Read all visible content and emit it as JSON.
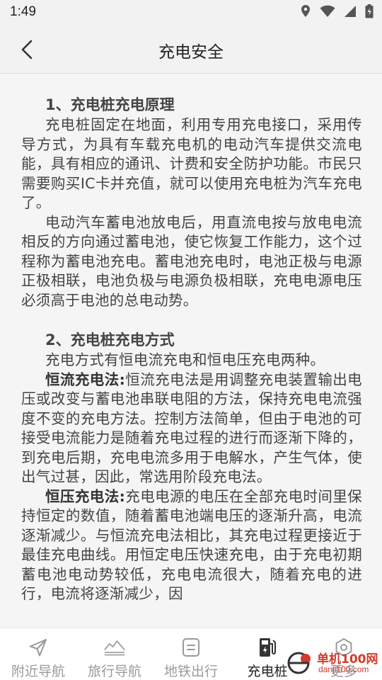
{
  "status_bar": {
    "time": "1:49",
    "icons": [
      "location-icon",
      "wifi-icon",
      "signal-icon",
      "battery-charging-icon"
    ]
  },
  "header": {
    "title": "充电安全",
    "back_icon": "chevron-left-icon"
  },
  "article": {
    "section1": {
      "heading": "1、充电桩充电原理",
      "p1": "充电桩固定在地面，利用专用充电接口，采用传导方式，为具有车载充电机的电动汽车提供交流电能，具有相应的通讯、计费和安全防护功能。市民只需要购买IC卡并充值，就可以使用充电桩为汽车充电了。",
      "p2": "电动汽车蓄电池放电后，用直流电按与放电电流相反的方向通过蓄电池，使它恢复工作能力，这个过程称为蓄电池充电。蓄电池充电时，电池正极与电源正极相联，电池负极与电源负极相联，充电电源电压必须高于电池的总电动势。"
    },
    "section2": {
      "heading": "2、充电桩充电方式",
      "p1": "充电方式有恒电流充电和恒电压充电两种。",
      "p2_label": "恒流充电法:",
      "p2_text": "恒流充电法是用调整充电装置输出电压或改变与蓄电池串联电阻的方法，保持充电电流强度不变的充电方法。控制方法简单，但由于电池的可接受电流能力是随着充电过程的进行而逐渐下降的，到充电后期，充电电流多用于电解水，产生气体，使出气过甚，因此，常选用阶段充电法。",
      "p3_label": "恒压充电法:",
      "p3_text": "充电电源的电压在全部充电时间里保持恒定的数值，随着蓄电池端电压的逐渐升高，电流逐渐减少。与恒流充电法相比，其充电过程更接近于最佳充电曲线。用恒定电压快速充电，由于充电初期蓄电池电动势较低，充电电流很大，随着充电的进行，电流将逐渐减少，因"
    }
  },
  "tab_bar": {
    "tabs": [
      {
        "label": "附近导航",
        "icon": "navigation-arrow-icon",
        "active": false
      },
      {
        "label": "旅行导航",
        "icon": "mountain-icon",
        "active": false
      },
      {
        "label": "地铁出行",
        "icon": "document-icon",
        "active": false
      },
      {
        "label": "充电桩",
        "icon": "charging-station-icon",
        "active": true
      },
      {
        "label": "更多",
        "icon": "settings-hex-icon",
        "active": false
      }
    ]
  },
  "watermark": {
    "line1": "单机100网",
    "line2": "danji100.com"
  },
  "colors": {
    "background": "#f5f5f5",
    "text": "#444444",
    "tab_inactive": "#9a9a9a",
    "tab_active": "#222222",
    "watermark_red": "#d43a2a"
  }
}
